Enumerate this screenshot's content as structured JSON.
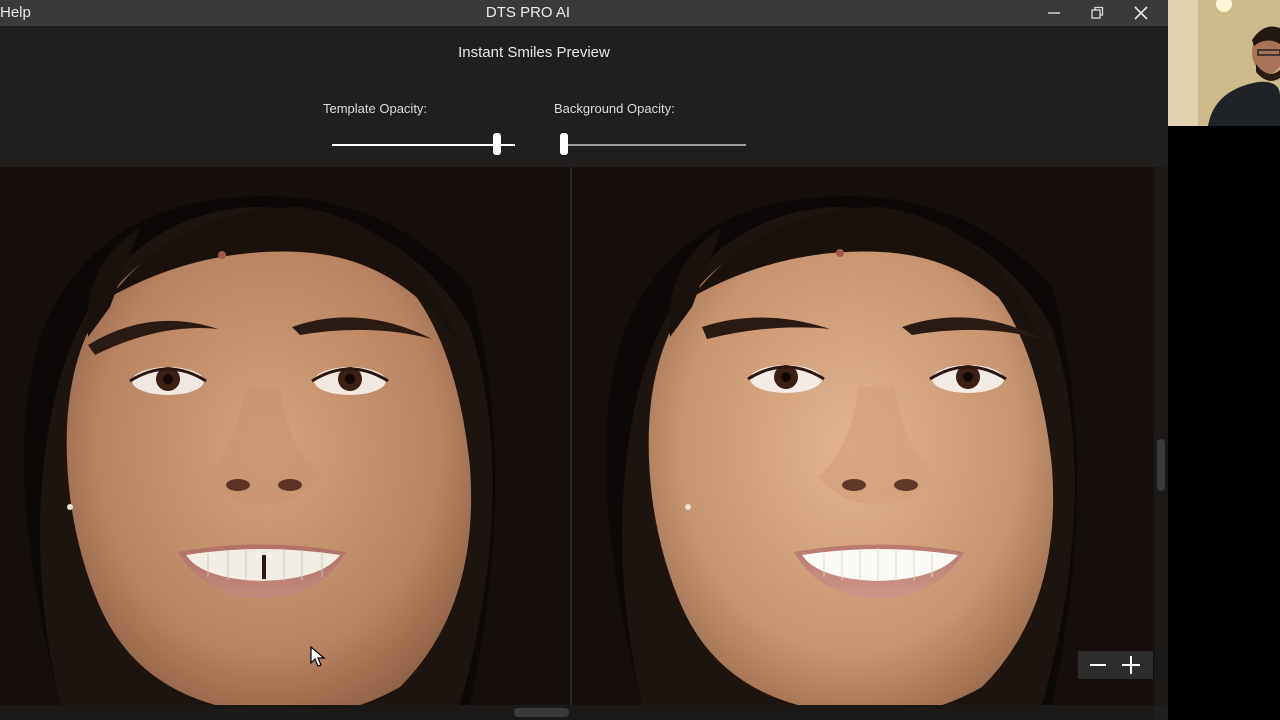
{
  "menu": {
    "help_label": "Help"
  },
  "window": {
    "title": "DTS PRO AI"
  },
  "icons": {
    "minimize": "minimize-icon",
    "restore": "restore-icon",
    "close": "close-icon",
    "zoom_out": "minus-icon",
    "zoom_in": "plus-icon"
  },
  "preview": {
    "title": "Instant Smiles Preview",
    "template_opacity": {
      "label": "Template Opacity:",
      "value": 0.9
    },
    "background_opacity": {
      "label": "Background Opacity:",
      "value": 0.0
    }
  },
  "colors": {
    "titlebar": "#3a3a3a",
    "panel": "#201f1d",
    "accent": "#ffffff"
  }
}
